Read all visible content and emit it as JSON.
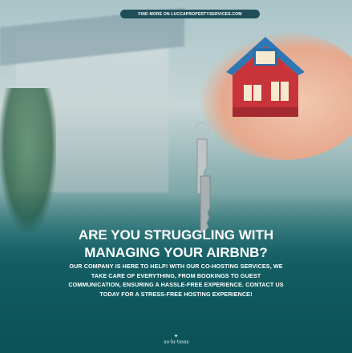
{
  "banner": {
    "url_text": "FIND MORE ON LUCCAPROPERTYSERVICES.COM"
  },
  "headline": {
    "line1": "ARE YOU STRUGGLING WITH",
    "line2": "MANAGING YOUR AIRBNB?"
  },
  "body": {
    "line1": "OUR COMPANY IS HERE TO HELP! WITH OUR CO-HOSTING SERVICES, WE",
    "line2": "TAKE CARE OF EVERYTHING, FROM BOOKINGS TO GUEST",
    "line3": "COMMUNICATION, ENSURING A HASSLE-FREE EXPERIENCE. CONTACT US",
    "line4": "TODAY FOR A STRESS-FREE HOSTING EXPERIENCE!"
  },
  "logo": {
    "text": "so·lu·tions"
  },
  "colors": {
    "teal": "#0f5e63",
    "house_red": "#c8343a",
    "roof_blue": "#2f77b3",
    "pill": "#1f4d59"
  }
}
